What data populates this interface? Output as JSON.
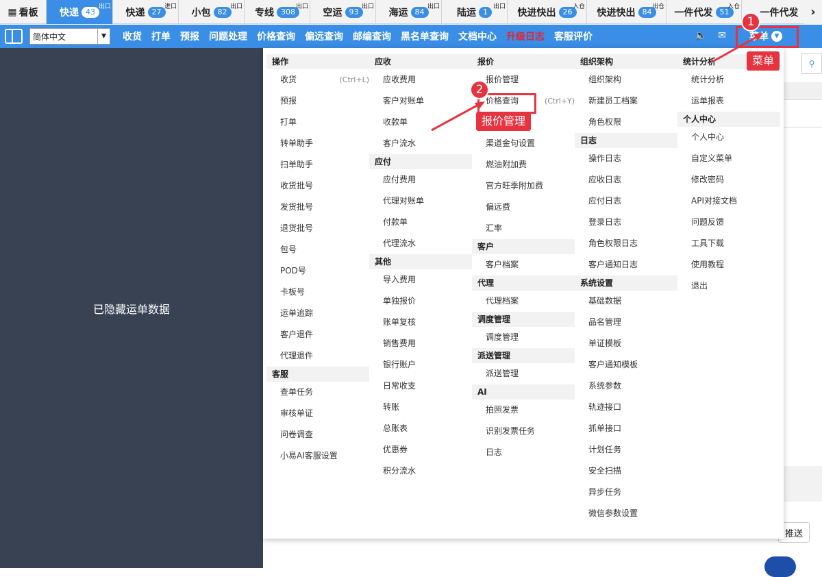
{
  "tabs": [
    {
      "label": "看板",
      "icon": "dashboard-icon"
    },
    {
      "label": "快递",
      "badge": "43",
      "sup": "出口",
      "active": true
    },
    {
      "label": "快递",
      "badge": "27",
      "sup": "进口"
    },
    {
      "label": "小包",
      "badge": "82",
      "sup": "出口"
    },
    {
      "label": "专线",
      "badge": "308",
      "sup": "出口"
    },
    {
      "label": "空运",
      "badge": "93",
      "sup": "出口"
    },
    {
      "label": "海运",
      "badge": "84",
      "sup": "出口"
    },
    {
      "label": "陆运",
      "badge": "1",
      "sup": "出口"
    },
    {
      "label": "快进快出",
      "badge": "26",
      "sup": "入仓"
    },
    {
      "label": "快进快出",
      "badge": "84",
      "sup": "出仓"
    },
    {
      "label": "一件代发",
      "badge": "51",
      "sup": "入仓"
    },
    {
      "label": "一件代发"
    }
  ],
  "nav": {
    "language": "简体中文",
    "links": [
      "收货",
      "打单",
      "预报",
      "问题处理",
      "价格查询",
      "偏远查询",
      "邮编查询",
      "黑名单查询",
      "文档中心",
      "升级日志",
      "客服评价"
    ],
    "menu_label": "菜单"
  },
  "left_panel": {
    "hidden_text": "已隐藏运单数据"
  },
  "push_button": "推送",
  "menu": {
    "col1": [
      {
        "section": "操作"
      },
      {
        "item": "收货",
        "shortcut": "(Ctrl+L)"
      },
      {
        "item": "预报"
      },
      {
        "item": "打单"
      },
      {
        "item": "转单助手"
      },
      {
        "item": "扫单助手"
      },
      {
        "item": "收货批号"
      },
      {
        "item": "发货批号"
      },
      {
        "item": "退货批号"
      },
      {
        "item": "包号"
      },
      {
        "item": "POD号"
      },
      {
        "item": "卡板号"
      },
      {
        "item": "运单追踪"
      },
      {
        "item": "客户退件"
      },
      {
        "item": "代理退件"
      },
      {
        "section": "客服"
      },
      {
        "item": "查单任务"
      },
      {
        "item": "审核单证"
      },
      {
        "item": "问卷调查"
      },
      {
        "item": "小易AI客服设置"
      }
    ],
    "col2": [
      {
        "section": "应收"
      },
      {
        "item": "应收费用"
      },
      {
        "item": "客户对账单"
      },
      {
        "item": "收款单"
      },
      {
        "item": "客户流水"
      },
      {
        "section": "应付"
      },
      {
        "item": "应付费用"
      },
      {
        "item": "代理对账单"
      },
      {
        "item": "付款单"
      },
      {
        "item": "代理流水"
      },
      {
        "section": "其他"
      },
      {
        "item": "导入费用"
      },
      {
        "item": "单独报价"
      },
      {
        "item": "账单复核"
      },
      {
        "item": "销售费用"
      },
      {
        "item": "银行账户"
      },
      {
        "item": "日常收支"
      },
      {
        "item": "转账"
      },
      {
        "item": "总账表"
      },
      {
        "item": "优惠券"
      },
      {
        "item": "积分流水"
      }
    ],
    "col3": [
      {
        "section": "报价"
      },
      {
        "item": "报价管理"
      },
      {
        "item": "价格查询",
        "shortcut": "(Ctrl+Y)"
      },
      {
        "item": "报价管理",
        "annotation": true
      },
      {
        "item": "渠道金句设置"
      },
      {
        "item": "燃油附加费"
      },
      {
        "item": "官方旺季附加费"
      },
      {
        "item": "偏远费"
      },
      {
        "item": "汇率"
      },
      {
        "section": "客户"
      },
      {
        "item": "客户档案"
      },
      {
        "section": "代理"
      },
      {
        "item": "代理档案"
      },
      {
        "section": "调度管理"
      },
      {
        "item": "调度管理"
      },
      {
        "section": "派送管理"
      },
      {
        "item": "派送管理"
      },
      {
        "section": "AI"
      },
      {
        "item": "拍照发票"
      },
      {
        "item": "识别发票任务"
      },
      {
        "item": "日志"
      }
    ],
    "col4": [
      {
        "section": "组织架构"
      },
      {
        "item": "组织架构"
      },
      {
        "item": "新建员工档案"
      },
      {
        "item": "角色权限"
      },
      {
        "section": "日志"
      },
      {
        "item": "操作日志"
      },
      {
        "item": "应收日志"
      },
      {
        "item": "应付日志"
      },
      {
        "item": "登录日志"
      },
      {
        "item": "角色权限日志"
      },
      {
        "item": "客户通知日志"
      },
      {
        "section": "系统设置"
      },
      {
        "item": "基础数据"
      },
      {
        "item": "品名管理"
      },
      {
        "item": "单证模板"
      },
      {
        "item": "客户通知模板"
      },
      {
        "item": "系统参数"
      },
      {
        "item": "轨迹接口"
      },
      {
        "item": "抓单接口"
      },
      {
        "item": "计划任务"
      },
      {
        "item": "安全扫描"
      },
      {
        "item": "异步任务"
      },
      {
        "item": "微信参数设置"
      }
    ],
    "col5": [
      {
        "section": "统计分析"
      },
      {
        "item": "统计分析"
      },
      {
        "item": "运单报表"
      },
      {
        "section": "个人中心"
      },
      {
        "item": "个人中心"
      },
      {
        "item": "自定义菜单"
      },
      {
        "item": "修改密码"
      },
      {
        "item": "API对接文档"
      },
      {
        "item": "问题反馈"
      },
      {
        "item": "工具下载"
      },
      {
        "item": "使用教程"
      },
      {
        "item": "退出"
      }
    ]
  },
  "annotations": {
    "step1": "1",
    "step2": "2",
    "label1": "菜单",
    "label2": "报价管理"
  },
  "colors": {
    "primary": "#3a8ee6",
    "sidebar": "#384253",
    "annotation": "#e63340"
  }
}
